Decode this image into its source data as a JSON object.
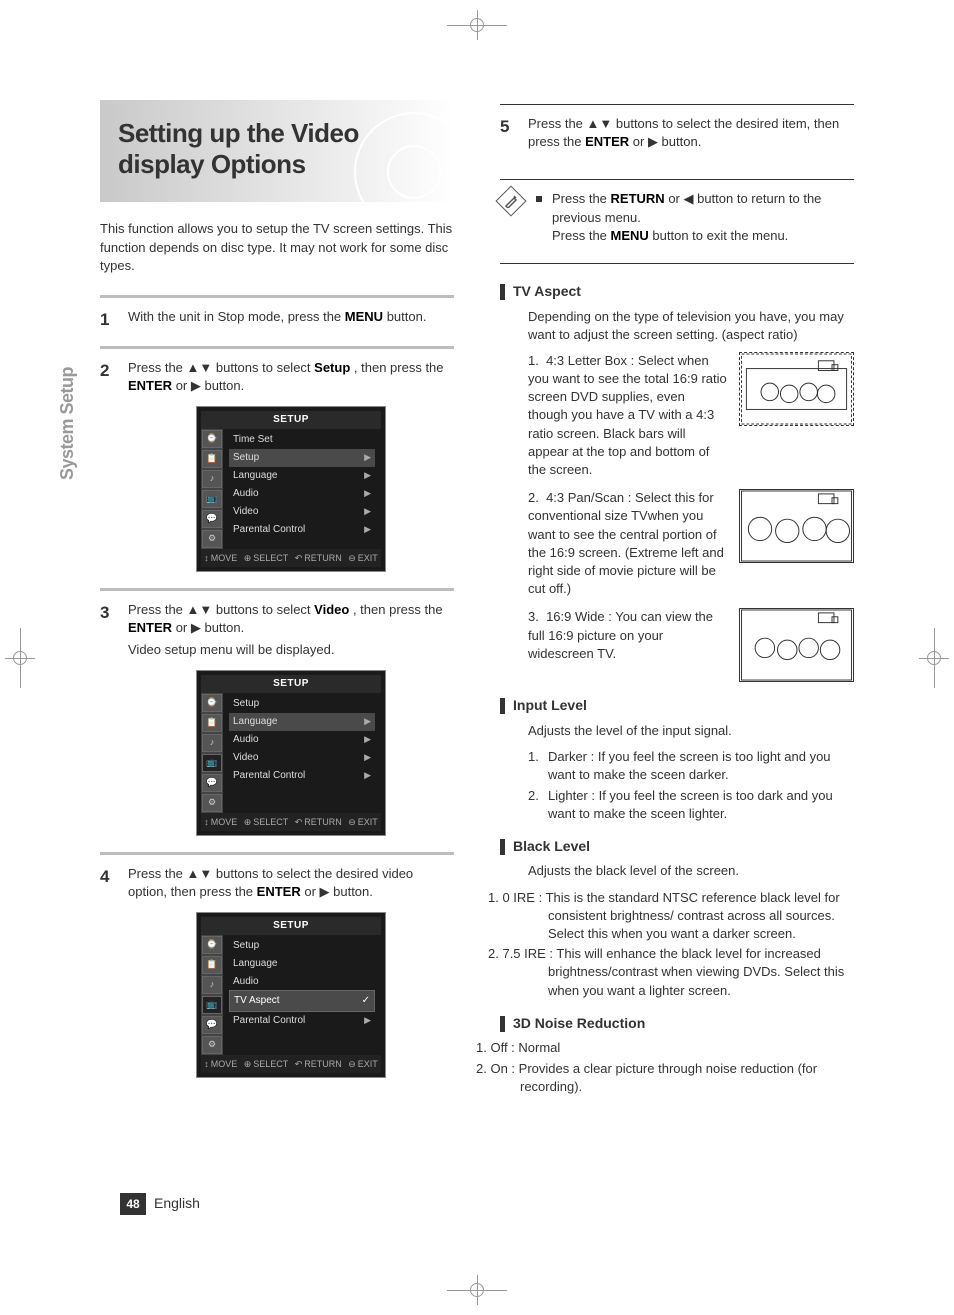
{
  "sideTab": "System Setup",
  "title": "Setting up the Video display Options",
  "intro": "This function allows you to setup the TV screen settings. This function depends on disc type. It may not work for some disc types.",
  "steps": {
    "s1": {
      "num": "1",
      "text_a": "With the unit in Stop mode, press the ",
      "button": "MENU",
      "text_b": " button."
    },
    "s2": {
      "num": "2",
      "text_a": "Press the ▲▼ buttons to select ",
      "keyword": "Setup",
      "text_b": ", then press the ",
      "enter": "ENTER",
      "text_c": " or ▶ button."
    },
    "s3": {
      "num": "3",
      "text_a": "Press the ▲▼ buttons to select ",
      "keyword": "Video",
      "text_b": ", then press the ",
      "enter": "ENTER",
      "text_c": " or ▶ button.",
      "extra": "Video setup menu will be displayed."
    },
    "s4": {
      "num": "4",
      "text_a": "Press the ▲▼ buttons to select the desired video option, then press the ",
      "enter": "ENTER",
      "text_b": " or ▶ button."
    },
    "s5": {
      "num": "5",
      "text_a": "Press the ▲▼ buttons to select the desired item, then press the ",
      "enter": "ENTER",
      "text_b": " or ▶ button."
    }
  },
  "menuScreens": {
    "title": "SETUP",
    "rows1": [
      "Time Set",
      "Setup",
      "Language",
      "Audio",
      "Video",
      "Parental Control"
    ],
    "rows2_main": [
      "Setup",
      "Language",
      "Audio",
      "Video",
      "Parental Control"
    ],
    "rows3_main": [
      "Setup",
      "Language",
      "Audio",
      "Video",
      "Parental Control"
    ],
    "rows3_sub": [
      "TV Aspect",
      "Input Level",
      "Black Level",
      "3D Noise Reduction"
    ],
    "nav": [
      "MOVE",
      "SELECT",
      "RETURN",
      "EXIT"
    ]
  },
  "note": {
    "l1a": "Press the ",
    "l1_btn": "RETURN",
    "l1b": " or ◀ button to return to the previous menu.",
    "l2a": "Press the ",
    "l2_btn": "MENU",
    "l2b": " button to exit the menu."
  },
  "sections": {
    "tvaspect": {
      "heading": "TV Aspect",
      "intro": "Depending on the type of television you have, you may want to adjust the screen setting. (aspect ratio)",
      "items": [
        {
          "n": "1.",
          "label": "4:3 Letter  Box : Select when you want to see the total 16:9 ratio screen DVD supplies, even though you have a TV with a 4:3 ratio screen. Black bars will appear at the top and bottom of the screen."
        },
        {
          "n": "2.",
          "label": "4:3 Pan/Scan : Select this for conventional size TVwhen you want to see the central portion of the 16:9 screen. (Extreme left and right side of movie picture will be cut off.)"
        },
        {
          "n": "3.",
          "label": "16:9 Wide : You can view the full 16:9 picture on your widescreen TV."
        }
      ]
    },
    "inputlevel": {
      "heading": "Input Level",
      "intro": "Adjusts the level of the input signal.",
      "items": [
        {
          "n": "1.",
          "label": "Darker : If you feel the screen is too light and you want to make the sceen darker."
        },
        {
          "n": "2.",
          "label": "Lighter : If you feel the screen is too dark and you want to make the sceen lighter."
        }
      ]
    },
    "blacklevel": {
      "heading": "Black Level",
      "intro": "Adjusts the black level of the screen.",
      "items": [
        {
          "n": "1.",
          "label": "0 IRE : This is the standard NTSC reference black level for consistent brightness/ contrast across all sources. Select this when you want a darker screen."
        },
        {
          "n": "2.",
          "label": "7.5 IRE : This will  enhance the black level for increased brightness/contrast when viewing DVDs. Select this when you want a lighter screen."
        }
      ]
    },
    "noise": {
      "heading": "3D Noise Reduction",
      "items": [
        {
          "n": "1.",
          "label": "Off : Normal"
        },
        {
          "n": "2.",
          "label": "On : Provides a clear picture through noise reduction (for recording)."
        }
      ]
    }
  },
  "footer": {
    "page": "48",
    "lang": "English"
  }
}
